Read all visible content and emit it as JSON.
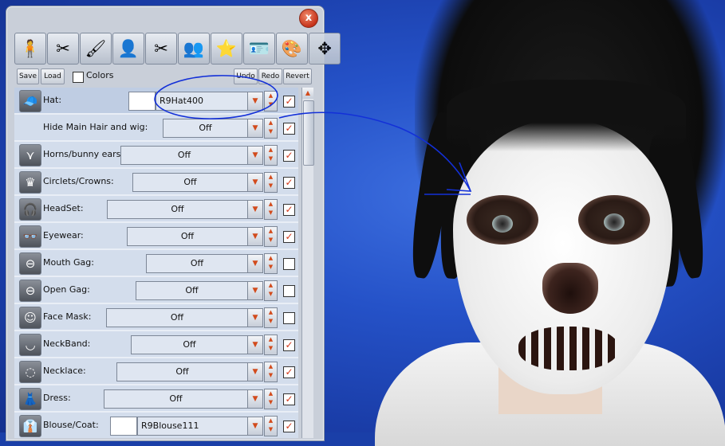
{
  "window": {
    "close_label": "x"
  },
  "toolbar": {
    "tools": [
      {
        "name": "body-parts-icon",
        "glyph": "🧍"
      },
      {
        "name": "hair-icon",
        "glyph": "✂"
      },
      {
        "name": "makeup-brush-icon",
        "glyph": "🖌"
      },
      {
        "name": "face-shape-icon",
        "glyph": "👤"
      },
      {
        "name": "tools-icon",
        "glyph": "✂"
      },
      {
        "name": "heads-icon",
        "glyph": "👥"
      },
      {
        "name": "favorite-heads-icon",
        "glyph": "⭐"
      },
      {
        "name": "id-card-icon",
        "glyph": "🪪"
      },
      {
        "name": "color-palette-icon",
        "glyph": "🎨"
      },
      {
        "name": "move-arrows-icon",
        "glyph": "✥"
      }
    ]
  },
  "actions": {
    "save": "Save",
    "load": "Load",
    "colors": "Colors",
    "undo": "Undo",
    "redo": "Redo",
    "revert": "Revert"
  },
  "rows": [
    {
      "label": "Hat:",
      "value": "R9Hat400",
      "checked": true,
      "icon": "hat-icon",
      "glyph": "🧢",
      "thumb": true
    },
    {
      "label": "Hide Main Hair and wig:",
      "value": "Off",
      "checked": true,
      "icon": "",
      "glyph": "",
      "thumb": false
    },
    {
      "label": "Horns/bunny ears:",
      "value": "Off",
      "checked": true,
      "icon": "horns-icon",
      "glyph": "⋎",
      "thumb": false
    },
    {
      "label": "Circlets/Crowns:",
      "value": "Off",
      "checked": true,
      "icon": "crown-icon",
      "glyph": "♛",
      "thumb": false
    },
    {
      "label": "HeadSet:",
      "value": "Off",
      "checked": true,
      "icon": "headset-icon",
      "glyph": "🎧",
      "thumb": false
    },
    {
      "label": "Eyewear:",
      "value": "Off",
      "checked": true,
      "icon": "glasses-icon",
      "glyph": "👓",
      "thumb": false
    },
    {
      "label": "Mouth Gag:",
      "value": "Off",
      "checked": false,
      "icon": "mouth-gag-icon",
      "glyph": "⊖",
      "thumb": false
    },
    {
      "label": "Open Gag:",
      "value": "Off",
      "checked": false,
      "icon": "open-gag-icon",
      "glyph": "⊖",
      "thumb": false
    },
    {
      "label": "Face Mask:",
      "value": "Off",
      "checked": false,
      "icon": "face-mask-icon",
      "glyph": "☺",
      "thumb": false
    },
    {
      "label": "NeckBand:",
      "value": "Off",
      "checked": true,
      "icon": "neckband-icon",
      "glyph": "◡",
      "thumb": false
    },
    {
      "label": "Necklace:",
      "value": "Off",
      "checked": true,
      "icon": "necklace-icon",
      "glyph": "◌",
      "thumb": false
    },
    {
      "label": "Dress:",
      "value": "Off",
      "checked": true,
      "icon": "dress-icon",
      "glyph": "👗",
      "thumb": false
    },
    {
      "label": "Blouse/Coat:",
      "value": "R9Blouse111",
      "checked": true,
      "icon": "blouse-icon",
      "glyph": "👔",
      "thumb": true
    }
  ],
  "check_mark": "✓",
  "arrow_down": "▼",
  "arrow_up": "▲",
  "colors_accent": {
    "annotation": "#1330d8",
    "check": "#d2381b",
    "arrow": "#d24b1c"
  }
}
